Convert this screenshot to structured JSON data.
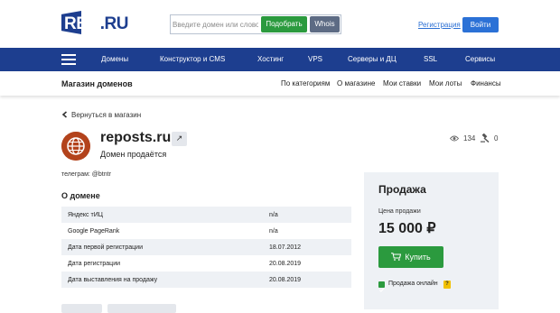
{
  "header": {
    "logo_text": "REG.RU",
    "search": {
      "placeholder": "Введите домен или слово"
    },
    "pick_button": "Подобрать",
    "whois_button": "Whois",
    "register_link": "Регистрация",
    "login_button": "Войти"
  },
  "nav": {
    "items": [
      "Домены",
      "Конструктор и CMS",
      "Хостинг",
      "VPS",
      "Серверы и ДЦ",
      "SSL",
      "Сервисы"
    ]
  },
  "subbar": {
    "title": "Магазин доменов",
    "links": [
      "По категориям",
      "О магазине",
      "Мои ставки",
      "Мои лоты",
      "Финансы"
    ]
  },
  "back_link": "Вернуться в магазин",
  "domain": {
    "name": "reposts.ru",
    "status": "Домен продаётся",
    "views": "134",
    "bids": "0",
    "contact": "телеграм: @btntr"
  },
  "about": {
    "title": "О домене",
    "rows": [
      {
        "key": "Яндекс тИЦ",
        "value": "n/a"
      },
      {
        "key": "Google PageRank",
        "value": "n/a"
      },
      {
        "key": "Дата первой регистрации",
        "value": "18.07.2012"
      },
      {
        "key": "Дата регистрации",
        "value": "20.08.2019"
      },
      {
        "key": "Дата выставления на продажу",
        "value": "20.08.2019"
      }
    ]
  },
  "sale": {
    "title": "Продажа",
    "price_label": "Цена продажи",
    "price": "15 000 ₽",
    "buy_button": "Купить",
    "online_label": "Продажа онлайн",
    "help": "?"
  },
  "colors": {
    "brand_blue": "#1d3e8f",
    "green": "#2b9a3e",
    "link_blue": "#2b6fd3",
    "panel_bg": "#eef1f5"
  }
}
